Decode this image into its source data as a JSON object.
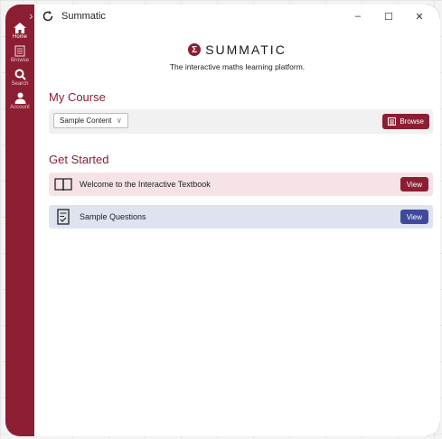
{
  "window": {
    "title": "Summatic"
  },
  "sidebar": {
    "items": [
      {
        "label": "Home",
        "icon": "home-icon"
      },
      {
        "label": "Browse",
        "icon": "book-icon"
      },
      {
        "label": "Search",
        "icon": "search-icon"
      },
      {
        "label": "Account",
        "icon": "user-icon"
      }
    ]
  },
  "header": {
    "logo_text": "SUMMATIC",
    "tagline": "The interactive maths learning platform."
  },
  "my_course": {
    "title": "My Course",
    "selected": "Sample Content",
    "browse_label": "Browse"
  },
  "get_started": {
    "title": "Get Started",
    "items": [
      {
        "label": "Welcome to the Interactive Textbook",
        "button": "View"
      },
      {
        "label": "Sample Questions",
        "button": "View"
      }
    ]
  },
  "colors": {
    "brand": "#8b1e33",
    "accent_blue": "#3f4a9a"
  }
}
